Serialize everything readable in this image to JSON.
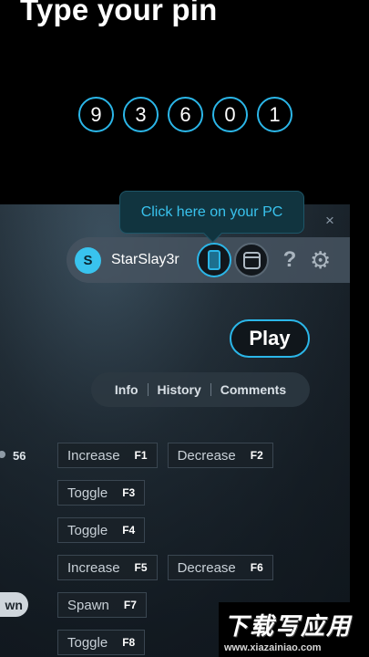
{
  "header": {
    "title": "Type your pin"
  },
  "pin": {
    "digits": [
      "9",
      "3",
      "6",
      "0",
      "1"
    ]
  },
  "tooltip": {
    "text": "Click here on your PC"
  },
  "close": {
    "glyph": "×"
  },
  "user": {
    "avatar_letter": "S",
    "name": "StarSlay3r"
  },
  "toolbar": {
    "help_glyph": "?",
    "settings_glyph": "⚙"
  },
  "play": {
    "label": "Play"
  },
  "tabs": [
    {
      "label": "Info"
    },
    {
      "label": "History"
    },
    {
      "label": "Comments"
    }
  ],
  "slider": {
    "value": "56"
  },
  "spawn_pill": {
    "label": "wn"
  },
  "hotkeys": [
    [
      {
        "label": "Increase",
        "key": "F1"
      },
      {
        "label": "Decrease",
        "key": "F2"
      }
    ],
    [
      {
        "label": "Toggle",
        "key": "F3"
      }
    ],
    [
      {
        "label": "Toggle",
        "key": "F4"
      }
    ],
    [
      {
        "label": "Increase",
        "key": "F5"
      },
      {
        "label": "Decrease",
        "key": "F6"
      }
    ],
    [
      {
        "label": "Spawn",
        "key": "F7"
      }
    ],
    [
      {
        "label": "Toggle",
        "key": "F8"
      }
    ]
  ],
  "watermark": {
    "main": "下载写应用",
    "sub": "www.xiazainiao.com"
  },
  "colors": {
    "accent": "#2bb6e8",
    "background": "#000000",
    "panel": "#26333d"
  }
}
